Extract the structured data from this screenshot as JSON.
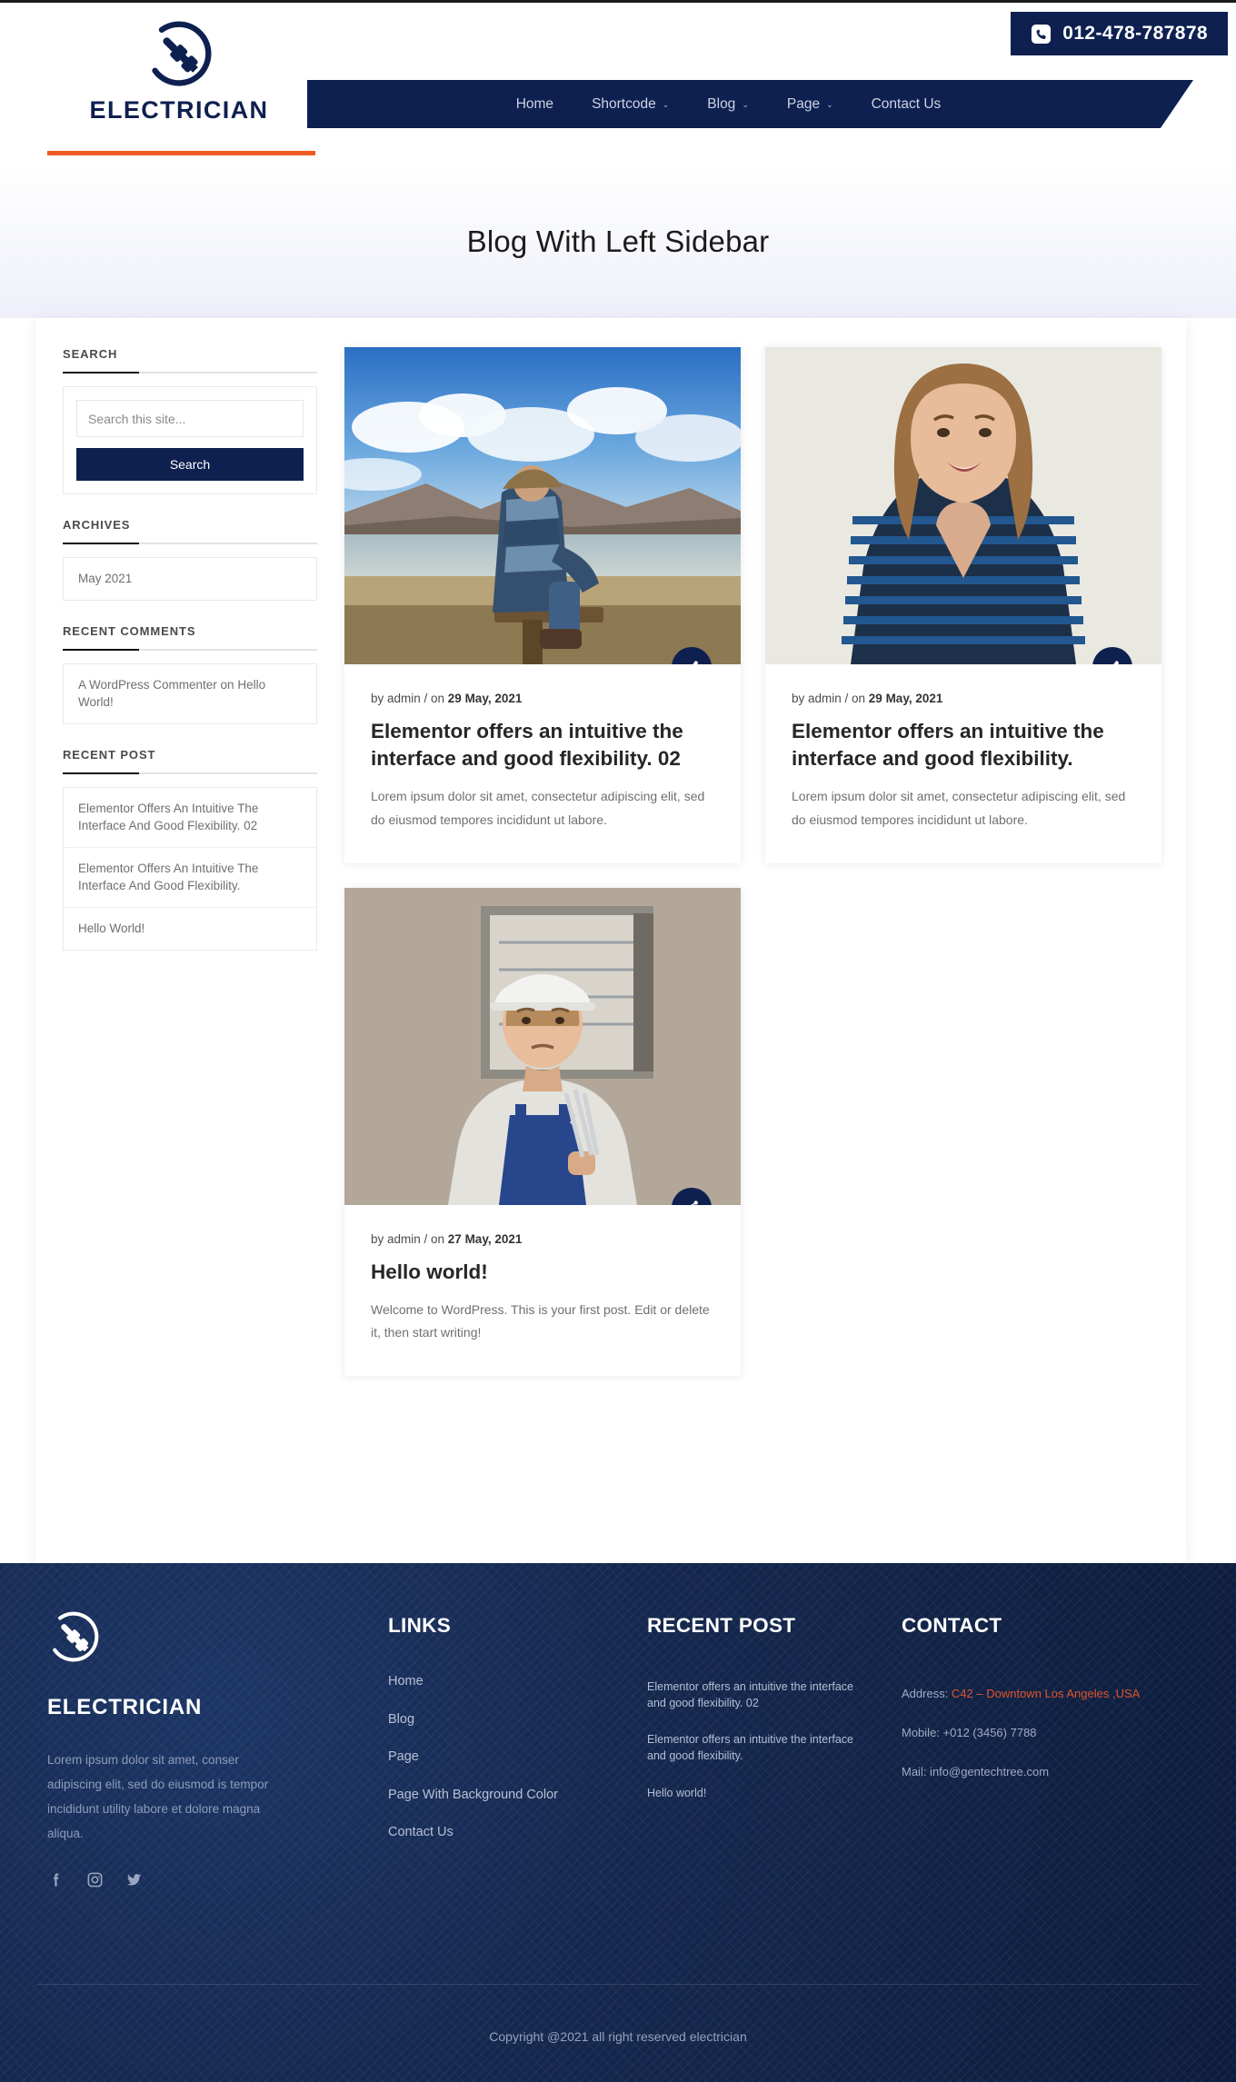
{
  "header": {
    "brand_name": "ELECTRICIAN",
    "phone": "012-478-787878",
    "phone_icon": "phone-icon",
    "logo_icon": "plug-circle-logo-icon",
    "nav": [
      {
        "label": "Home",
        "has_dropdown": false
      },
      {
        "label": "Shortcode",
        "has_dropdown": true
      },
      {
        "label": "Blog",
        "has_dropdown": true
      },
      {
        "label": "Page",
        "has_dropdown": true
      },
      {
        "label": "Contact Us",
        "has_dropdown": false
      }
    ],
    "caret": "⌄"
  },
  "hero": {
    "title": "Blog With Left Sidebar"
  },
  "sidebar": {
    "search": {
      "title": "SEARCH",
      "placeholder": "Search this site...",
      "value": "",
      "button_label": "Search"
    },
    "archives": {
      "title": "ARCHIVES",
      "items": [
        "May 2021"
      ]
    },
    "recent_comments": {
      "title": "RECENT COMMENTS",
      "items": [
        "A WordPress Commenter on Hello World!"
      ]
    },
    "recent_post": {
      "title": "RECENT POST",
      "items": [
        "Elementor Offers An Intuitive The Interface And Good Flexibility. 02",
        "Elementor Offers An Intuitive The Interface And Good Flexibility.",
        "Hello World!"
      ]
    }
  },
  "posts": [
    {
      "author_prefix": "by admin / on ",
      "date": "29 May, 2021",
      "title": "Elementor offers an intuitive the interface and good flexibility. 02",
      "excerpt": "Lorem ipsum dolor sit amet, consectetur adipiscing elit, sed do eiusmod tempores incididunt ut labore.",
      "image": "man-sitting-on-bench-overlooking-lake-and-mountains",
      "share_icon": "share-icon"
    },
    {
      "author_prefix": "by admin / on ",
      "date": "29 May, 2021",
      "title": "Elementor offers an intuitive the interface and good flexibility.",
      "excerpt": "Lorem ipsum dolor sit amet, consectetur adipiscing elit, sed do eiusmod tempores incididunt ut labore.",
      "image": "smiling-woman-in-striped-sweater-portrait",
      "share_icon": "share-icon"
    },
    {
      "author_prefix": "by admin / on ",
      "date": "27 May, 2021",
      "title": "Hello world!",
      "excerpt": "Welcome to WordPress. This is your first post. Edit or delete it, then start writing!",
      "image": "electrician-with-white-hard-hat-holding-pliers",
      "share_icon": "share-icon"
    }
  ],
  "footer": {
    "brand_name": "ELECTRICIAN",
    "logo_icon": "plug-circle-logo-icon",
    "description": "Lorem ipsum dolor sit amet, conser adipiscing elit, sed do eiusmod is tempor incididunt utility labore et dolore magna aliqua.",
    "social": [
      {
        "name": "facebook-icon"
      },
      {
        "name": "instagram-icon"
      },
      {
        "name": "twitter-icon"
      }
    ],
    "links": {
      "title": "LINKS",
      "items": [
        "Home",
        "Blog",
        "Page",
        "Page With Background Color",
        "Contact Us"
      ]
    },
    "recent_post": {
      "title": "RECENT POST",
      "items": [
        "Elementor offers an intuitive the interface and good flexibility. 02",
        "Elementor offers an intuitive the interface and good flexibility.",
        "Hello world!"
      ]
    },
    "contact": {
      "title": "CONTACT",
      "address_label": "Address: ",
      "address_value": "C42 – Downtown Los Angeles ,USA",
      "mobile": "Mobile: +012 (3456) 7788",
      "mail": "Mail: info@gentechtree.com"
    },
    "copyright": "Copyright @2021 all right reserved electrician"
  },
  "colors": {
    "navy": "#0e2050",
    "orange": "#ef5a24",
    "address_red": "#e0542c",
    "footer_bg": "#14274d"
  }
}
